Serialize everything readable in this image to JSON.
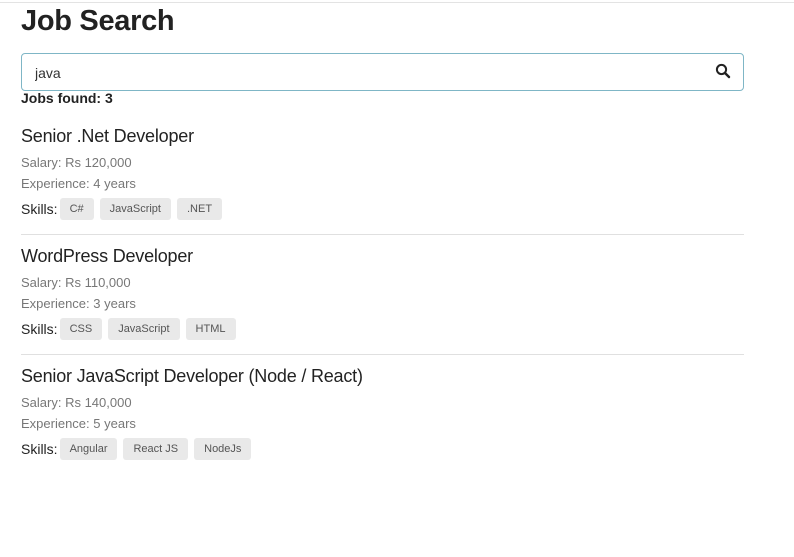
{
  "page": {
    "title": "Job Search"
  },
  "search": {
    "value": "java",
    "placeholder": ""
  },
  "results": {
    "count_text": "Jobs found: 3"
  },
  "jobs": [
    {
      "title": "Senior .Net Developer",
      "salary": "Salary: Rs 120,000",
      "experience": "Experience: 4 years",
      "skills_label": "Skills:",
      "skills": [
        "C#",
        "JavaScript",
        ".NET"
      ]
    },
    {
      "title": "WordPress Developer",
      "salary": "Salary: Rs 110,000",
      "experience": "Experience: 3 years",
      "skills_label": "Skills:",
      "skills": [
        "CSS",
        "JavaScript",
        "HTML"
      ]
    },
    {
      "title": "Senior JavaScript Developer (Node / React)",
      "salary": "Salary: Rs 140,000",
      "experience": "Experience: 5 years",
      "skills_label": "Skills:",
      "skills": [
        "Angular",
        "React JS",
        "NodeJs"
      ]
    }
  ],
  "icons": {
    "search": "search-icon"
  },
  "colors": {
    "search_border": "#7fb6c6",
    "tag_bg": "#e9e9e9",
    "muted_text": "#777777"
  }
}
